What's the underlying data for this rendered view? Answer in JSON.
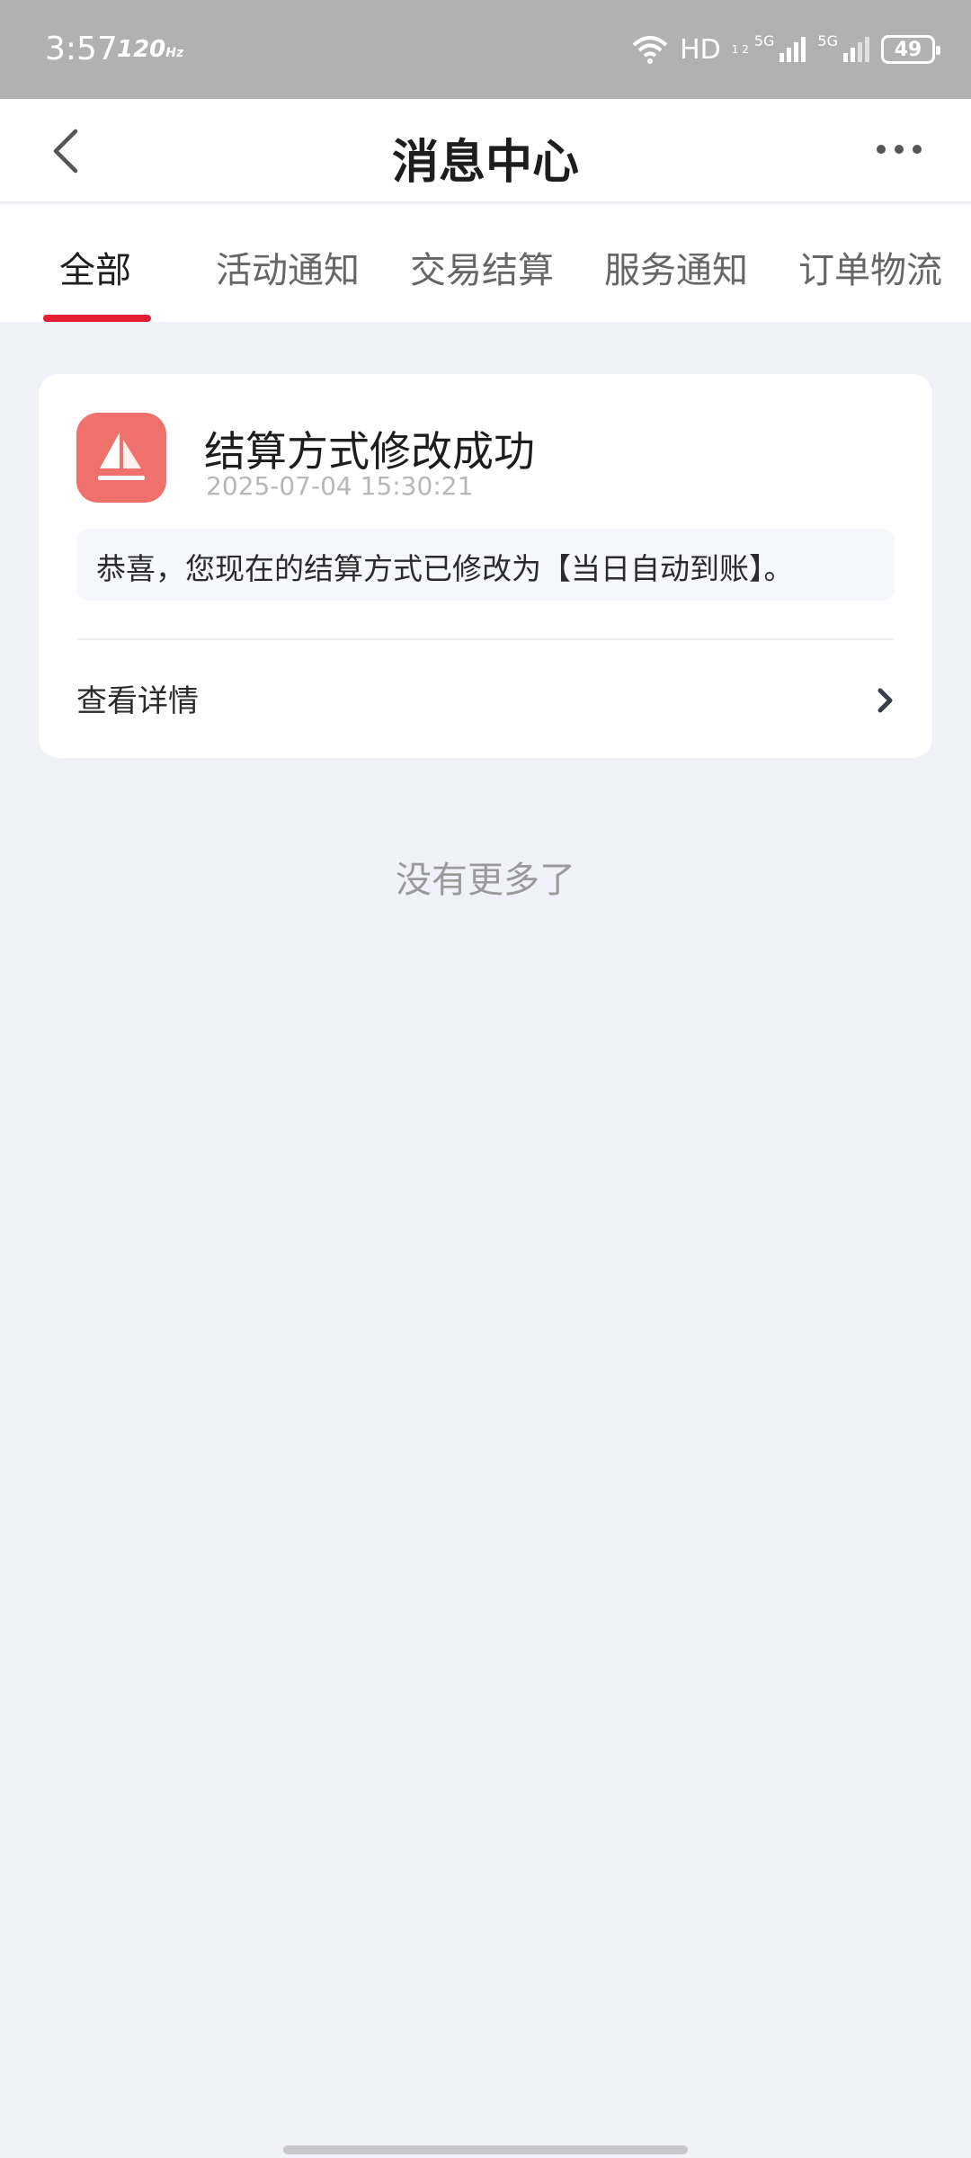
{
  "status_bar": {
    "time": "3:57",
    "refresh_rate": "120",
    "refresh_unit": "Hz",
    "network": "HD",
    "network_sub": "1 2",
    "sim1": "5G",
    "sim2": "5G",
    "battery": "49"
  },
  "header": {
    "title": "消息中心",
    "back_icon": "chevron-left-icon",
    "more_icon": "more-dots-icon"
  },
  "tabs": [
    {
      "label": "全部",
      "active": true
    },
    {
      "label": "活动通知",
      "active": false
    },
    {
      "label": "交易结算",
      "active": false
    },
    {
      "label": "服务通知",
      "active": false
    },
    {
      "label": "订单物流",
      "active": false
    }
  ],
  "messages": [
    {
      "icon": "sailboat-icon",
      "title": "结算方式修改成功",
      "time": "2025-07-04 15:30:21",
      "body": "恭喜，您现在的结算方式已修改为【当日自动到账】。",
      "action_label": "查看详情"
    }
  ],
  "footer": {
    "no_more": "没有更多了"
  },
  "colors": {
    "accent": "#e41c34",
    "icon_bg": "#f0706b",
    "page_bg": "#f0f1f9",
    "status_bar_bg": "#b1b1b1"
  }
}
